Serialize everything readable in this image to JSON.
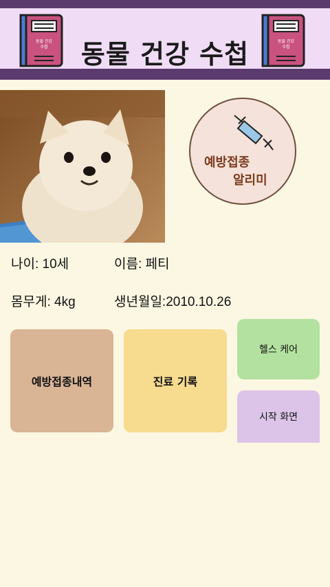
{
  "header": {
    "title": "동물 건강 수첩",
    "book_cover_label_1": "동물 건강",
    "book_cover_label_2": "수첩"
  },
  "vaccine_alarm": {
    "line1": "예방접종",
    "line2": "알리미"
  },
  "pet": {
    "age_label": "나이: 10세",
    "name_label": "이름: 페티",
    "weight_label": "몸무게: 4kg",
    "birth_label": "생년월일:2010.10.26"
  },
  "menu": {
    "vaccination_history": "예방접종내역",
    "medical_record": "진료 기록",
    "health_care": "헬스 케어",
    "start_screen": "시작 화면"
  },
  "colors": {
    "header_bg": "#f0dcf5",
    "header_bar": "#5b3a6e",
    "page_bg": "#fbf7e2",
    "tile_vaccination": "#d9b596",
    "tile_record": "#f7db8f",
    "tile_health": "#b3e2a0",
    "tile_start": "#dcc4e8"
  }
}
